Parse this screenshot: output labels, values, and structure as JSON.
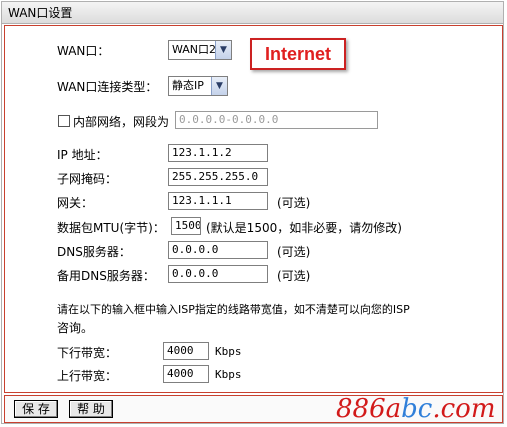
{
  "title": "WAN口设置",
  "annotation": "Internet",
  "wan_port": {
    "label": "WAN口：",
    "value": "WAN口2"
  },
  "conn_type": {
    "label": "WAN口连接类型：",
    "value": "静态IP"
  },
  "internal": {
    "label": "内部网络，网段为",
    "value": "0.0.0.0-0.0.0.0",
    "checked": false
  },
  "ip": {
    "label": "IP 地址：",
    "value": "123.1.1.2"
  },
  "mask": {
    "label": "子网掩码：",
    "value": "255.255.255.0"
  },
  "gateway": {
    "label": "网关：",
    "value": "123.1.1.1",
    "hint": "(可选)"
  },
  "mtu": {
    "label": "数据包MTU(字节)：",
    "value": "1500",
    "hint": "(默认是1500，如非必要，请勿修改)"
  },
  "dns1": {
    "label": "DNS服务器：",
    "value": "0.0.0.0",
    "hint": "(可选)"
  },
  "dns2": {
    "label": "备用DNS服务器：",
    "value": "0.0.0.0",
    "hint": "(可选)"
  },
  "bandwidth_note": {
    "line1": "请在以下的输入框中输入ISP指定的线路带宽值，如不清楚可以向您的ISP",
    "line2": "咨询。"
  },
  "downlink": {
    "label": "下行带宽：",
    "value": "4000",
    "unit": "Kbps"
  },
  "uplink": {
    "label": "上行带宽：",
    "value": "4000",
    "unit": "Kbps"
  },
  "buttons": {
    "save": "保 存",
    "help": "帮 助"
  },
  "watermark": {
    "part1": "886a",
    "part2": "bc",
    "part3": ".com"
  },
  "colors": {
    "border_red": "#c8402f",
    "annotation_red": "#e02020",
    "watermark_red": "#d21a1a",
    "watermark_blue": "#2f7fd9"
  }
}
